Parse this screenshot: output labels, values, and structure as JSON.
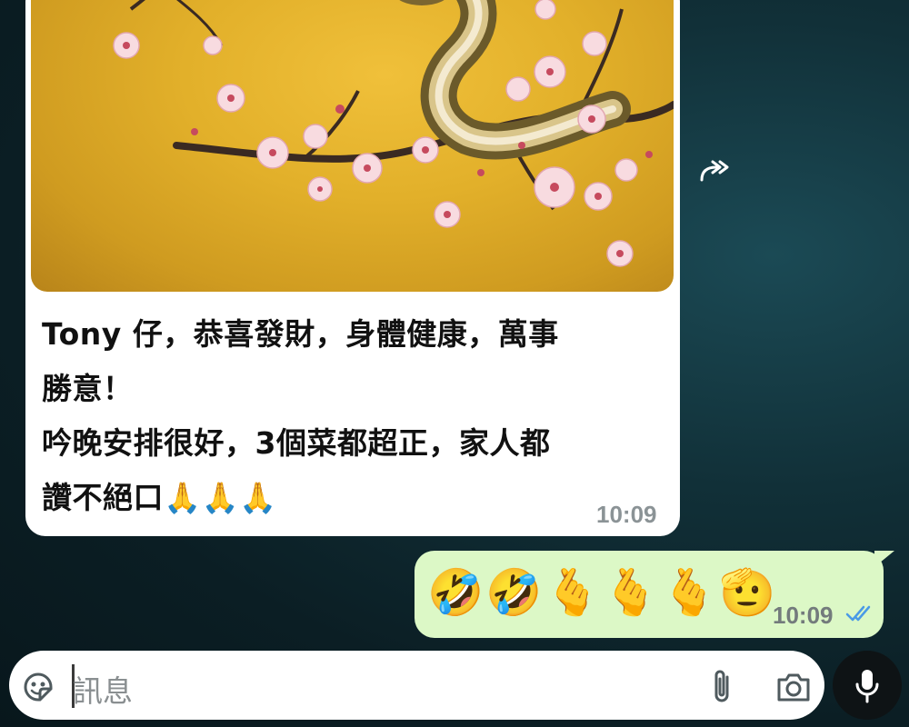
{
  "incoming_message": {
    "text": "Tony 仔，恭喜發財，身體健康，萬事\n勝意！\n吟晚安排很好，3個菜都超正，家人都\n讚不絕口🙏🙏🙏",
    "time": "10:09",
    "image": "golden-snake-on-cherry-blossom-branch"
  },
  "forward_icon": "forward-icon",
  "outgoing_message": {
    "emojis": "🤣🤣🫰🫰🫰🫡",
    "time": "10:09",
    "status_icon": "double-check-read-icon"
  },
  "composer": {
    "placeholder": "訊息",
    "left_icon": "sticker-icon",
    "attach_icon": "paperclip-icon",
    "camera_icon": "camera-icon",
    "send_icon": "microphone-icon"
  },
  "colors": {
    "outgoing_bubble": "#dcf8c6",
    "incoming_bubble": "#ffffff",
    "read_ticks": "#4a9ae6"
  }
}
